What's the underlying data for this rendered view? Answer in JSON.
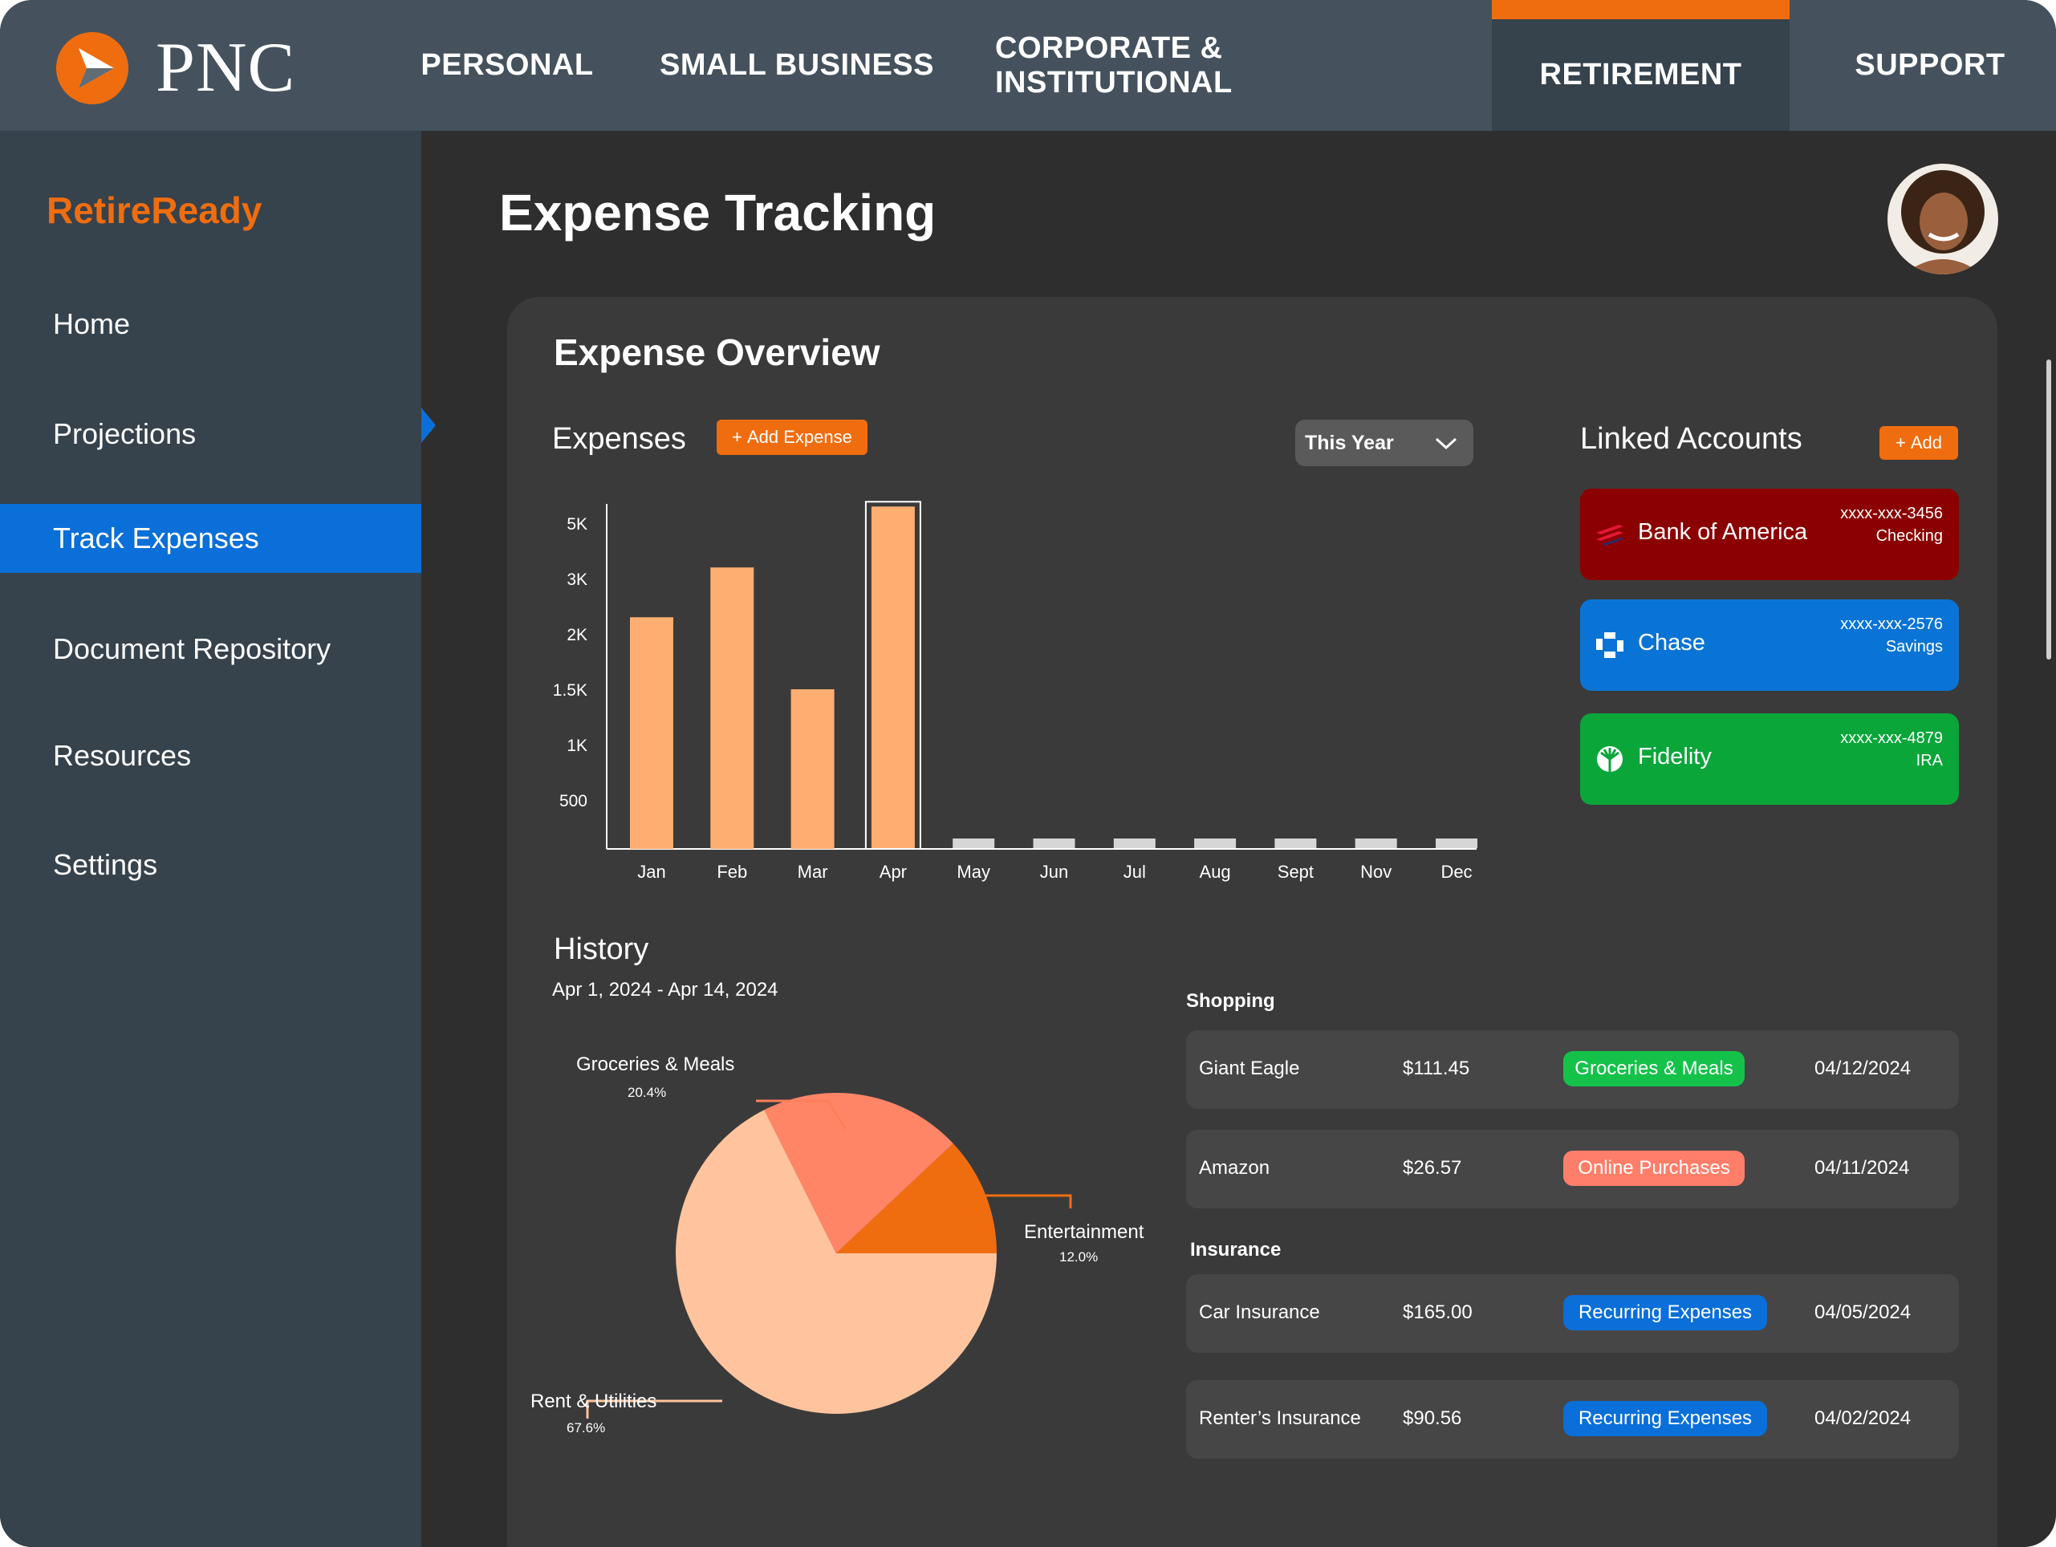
{
  "colors": {
    "accent": "#f06d0f",
    "nav_bg": "#45525d",
    "sidebar_bg": "#36424c",
    "active_blue": "#0a6fd8",
    "bar_orange": "#ffae72",
    "bar_gray": "#d6d6d6",
    "bank_of_america": "#8b0000",
    "chase": "#0a74d6",
    "fidelity": "#0aa63a",
    "tag_green": "#14c24a",
    "tag_salmon": "#ff7e6a",
    "tag_blue": "#0a6fd8"
  },
  "brand": {
    "logo_text": "PNC",
    "logo_icon": "pnc-logo-icon"
  },
  "topnav": {
    "items": [
      "PERSONAL",
      "SMALL BUSINESS",
      "CORPORATE & INSTITUTIONAL",
      "RETIREMENT",
      "SUPPORT"
    ],
    "active": "RETIREMENT"
  },
  "sidebar": {
    "title": "RetireReady",
    "items": [
      "Home",
      "Projections",
      "Track Expenses",
      "Document Repository",
      "Resources",
      "Settings"
    ],
    "active": "Track Expenses"
  },
  "page": {
    "title": "Expense Tracking",
    "avatar_icon": "user-avatar"
  },
  "overview": {
    "title": "Expense Overview",
    "expenses_label": "Expenses",
    "add_expense_label": "Add Expense",
    "period": "This Year"
  },
  "chart_data": [
    {
      "type": "bar",
      "title": "",
      "xlabel": "",
      "ylabel": "",
      "categories": [
        "Jan",
        "Feb",
        "Mar",
        "Apr",
        "May",
        "Jun",
        "Jul",
        "Aug",
        "Sept",
        "Nov",
        "Dec"
      ],
      "y_tick_labels": [
        "500",
        "1K",
        "1.5K",
        "2K",
        "3K",
        "5K"
      ],
      "values": [
        2300,
        3400,
        1500,
        5600,
        0,
        0,
        0,
        0,
        0,
        0,
        0
      ],
      "highlighted": "Apr",
      "grid": false
    },
    {
      "type": "pie",
      "title": "",
      "slices": [
        {
          "label": "Rent & Utilities",
          "pct_label": "67.6%",
          "value": 67.6,
          "color": "#ffc49e"
        },
        {
          "label": "Groceries & Meals",
          "pct_label": "20.4%",
          "value": 20.4,
          "color": "#ff8566"
        },
        {
          "label": "Entertainment",
          "pct_label": "12.0%",
          "value": 12.0,
          "color": "#f06d0f"
        }
      ]
    }
  ],
  "linked_accounts": {
    "title": "Linked Accounts",
    "add_label": "Add",
    "accounts": [
      {
        "name": "Bank of America",
        "number": "xxxx-xxx-3456",
        "type": "Checking",
        "icon": "bank-of-america-logo-icon"
      },
      {
        "name": "Chase",
        "number": "xxxx-xxx-2576",
        "type": "Savings",
        "icon": "chase-logo-icon"
      },
      {
        "name": "Fidelity",
        "number": "xxxx-xxx-4879",
        "type": "IRA",
        "icon": "fidelity-logo-icon"
      }
    ]
  },
  "history": {
    "title": "History",
    "date_range": "Apr 1, 2024 - Apr 14, 2024",
    "groups": [
      {
        "name": "Shopping",
        "rows": [
          {
            "merchant": "Giant Eagle",
            "amount": "$111.45",
            "tag": "Groceries & Meals",
            "date": "04/12/2024"
          },
          {
            "merchant": "Amazon",
            "amount": "$26.57",
            "tag": "Online Purchases",
            "date": "04/11/2024"
          }
        ]
      },
      {
        "name": "Insurance",
        "rows": [
          {
            "merchant": "Car Insurance",
            "amount": "$165.00",
            "tag": "Recurring Expenses",
            "date": "04/05/2024"
          },
          {
            "merchant": "Renter’s Insurance",
            "amount": "$90.56",
            "tag": "Recurring Expenses",
            "date": "04/02/2024"
          }
        ]
      }
    ]
  }
}
